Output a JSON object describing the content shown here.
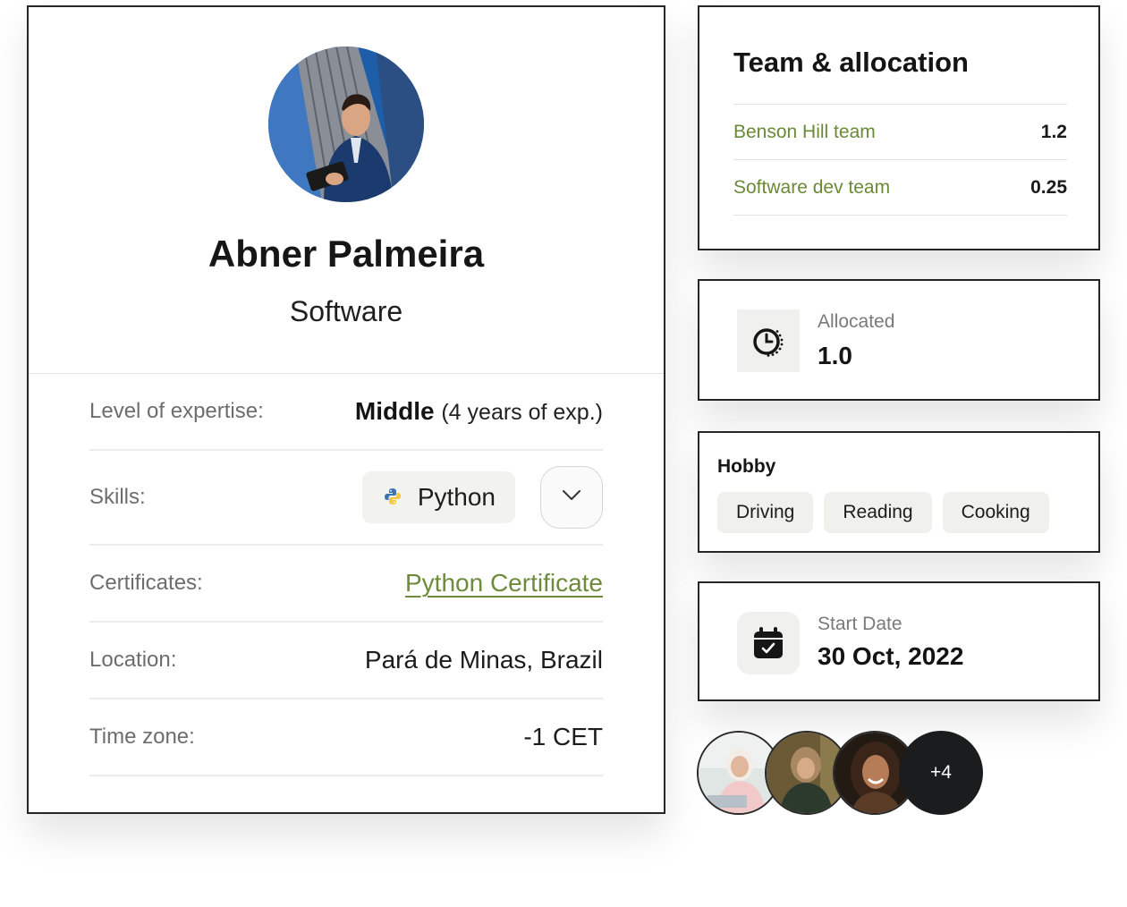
{
  "profile": {
    "name": "Abner Palmeira",
    "role": "Software",
    "avatar": "person-photo",
    "details": {
      "expertise_label": "Level of expertise:",
      "expertise_level": "Middle",
      "expertise_years": "(4 years of exp.)",
      "skills_label": "Skills:",
      "skill": "Python",
      "skill_icon": "python-icon",
      "certificates_label": "Certificates:",
      "certificate": "Python Certificate",
      "location_label": "Location:",
      "location": "Pará de Minas, Brazil",
      "timezone_label": "Time zone:",
      "timezone": "-1 CET"
    }
  },
  "team": {
    "title": "Team & allocation",
    "rows": [
      {
        "name": "Benson Hill team",
        "value": "1.2"
      },
      {
        "name": "Software dev team",
        "value": "0.25"
      }
    ]
  },
  "allocated": {
    "icon": "clock-icon",
    "label": "Allocated",
    "value": "1.0"
  },
  "hobby": {
    "title": "Hobby",
    "items": [
      "Driving",
      "Reading",
      "Cooking"
    ]
  },
  "start_date": {
    "icon": "calendar-check-icon",
    "label": "Start Date",
    "value": "30 Oct, 2022"
  },
  "team_members": {
    "more_label": "+4"
  },
  "colors": {
    "accent_green": "#6a8a37",
    "border": "#262626",
    "chip_bg": "#f0f0ed",
    "dark_badge": "#1b1c1d"
  }
}
